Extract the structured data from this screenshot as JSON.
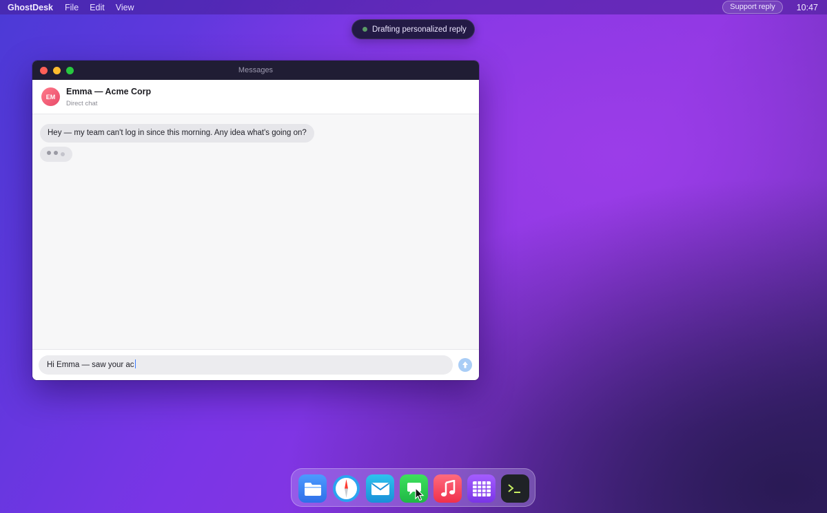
{
  "menubar": {
    "app_name": "GhostDesk",
    "menus": [
      "File",
      "Edit",
      "View"
    ],
    "support_label": "Support reply",
    "clock": "10:47"
  },
  "toast": {
    "text": "Drafting personalized reply",
    "dot_color": "#5a9a66"
  },
  "window": {
    "title": "Messages",
    "contact": {
      "initials": "EM",
      "name": "Emma — Acme Corp",
      "subtitle": "Direct chat"
    },
    "messages": [
      {
        "from": "Emma",
        "text": "Hey — my team can't log in since this morning. Any idea what's going on?"
      }
    ],
    "typing_indicator": true,
    "composer": {
      "value": "Hi Emma — saw your ac",
      "send_icon": "arrow-up-icon"
    }
  },
  "dock": {
    "apps": [
      {
        "name": "Files",
        "icon": "folder-icon"
      },
      {
        "name": "Safari",
        "icon": "compass-icon"
      },
      {
        "name": "Mail",
        "icon": "envelope-icon"
      },
      {
        "name": "Messages",
        "icon": "chat-bubble-icon"
      },
      {
        "name": "Music",
        "icon": "music-note-icon"
      },
      {
        "name": "Numbers",
        "icon": "table-grid-icon"
      },
      {
        "name": "Terminal",
        "icon": "terminal-icon"
      }
    ]
  },
  "colors": {
    "accent": "#3a7bff",
    "window_titlebar": "#201d34",
    "bubble": "#e6e6ea"
  }
}
